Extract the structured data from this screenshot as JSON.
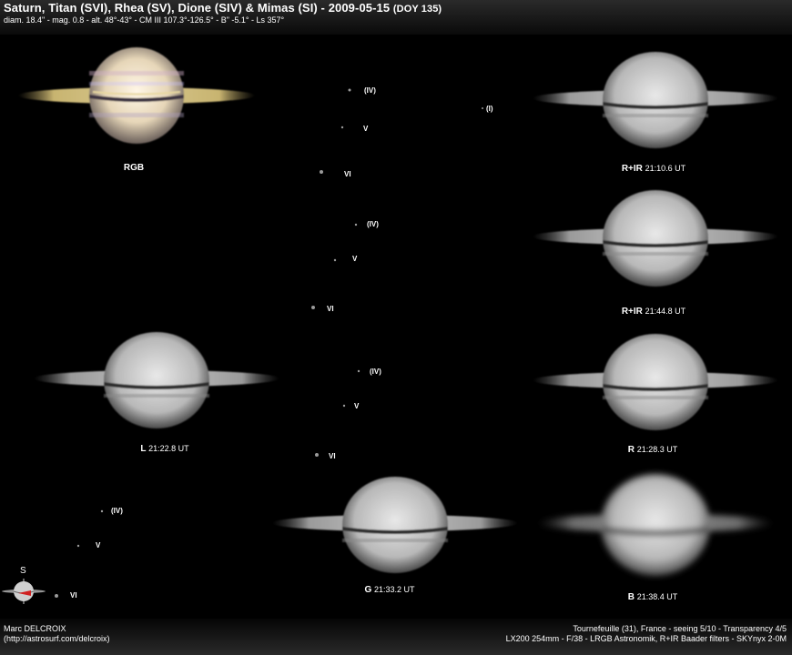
{
  "header": {
    "title": "Saturn, Titan (SVI), Rhea (SV), Dione (SIV) & Mimas (SI) - 2009-05-15",
    "doy": "(DOY 135)",
    "subtitle": "diam. 18.4\" - mag. 0.8 - alt. 48°-43° - CM III 107.3°-126.5° - B\" -5.1° - Ls 357°"
  },
  "panels": [
    {
      "filter": "RGB",
      "time": ""
    },
    {
      "filter": "R+IR",
      "time": "21:10.6 UT"
    },
    {
      "filter": "R+IR",
      "time": "21:44.8 UT"
    },
    {
      "filter": "L",
      "time": "21:22.8 UT"
    },
    {
      "filter": "R",
      "time": "21:28.3 UT"
    },
    {
      "filter": "G",
      "time": "21:33.2 UT"
    },
    {
      "filter": "B",
      "time": "21:38.4 UT"
    }
  ],
  "moons": {
    "dione": "(IV)",
    "rhea": "V",
    "titan": "VI",
    "mimas": "(I)"
  },
  "compass": {
    "label": "S"
  },
  "footer": {
    "author": "Marc DELCROIX",
    "url": "(http://astrosurf.com/delcroix)",
    "location": "Tournefeuille (31), France - seeing 5/10 - Transparency 4/5",
    "equipment": "LX200 254mm - F/38 - LRGB Astronomik, R+IR Baader filters - SKYnyx 2-0M"
  }
}
